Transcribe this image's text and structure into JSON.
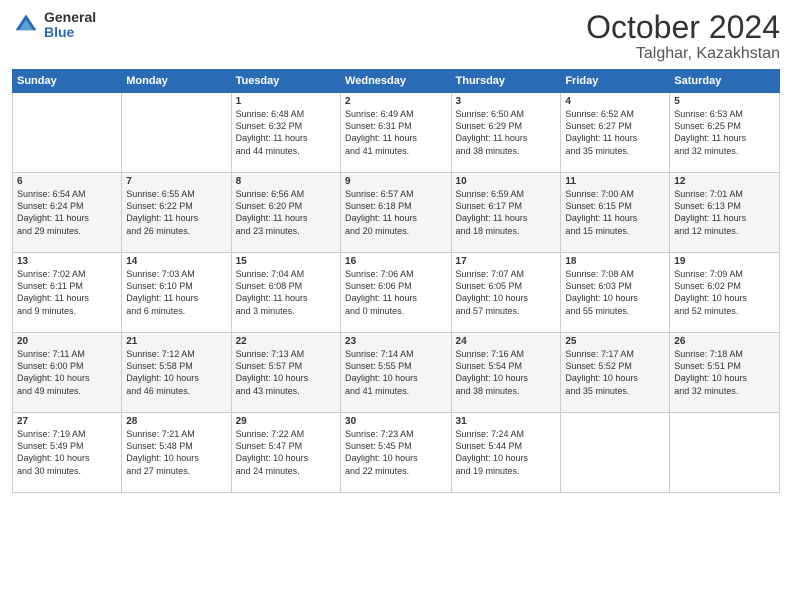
{
  "header": {
    "logo_general": "General",
    "logo_blue": "Blue",
    "month": "October 2024",
    "location": "Talghar, Kazakhstan"
  },
  "days_of_week": [
    "Sunday",
    "Monday",
    "Tuesday",
    "Wednesday",
    "Thursday",
    "Friday",
    "Saturday"
  ],
  "weeks": [
    [
      {
        "num": "",
        "detail": ""
      },
      {
        "num": "",
        "detail": ""
      },
      {
        "num": "1",
        "detail": "Sunrise: 6:48 AM\nSunset: 6:32 PM\nDaylight: 11 hours\nand 44 minutes."
      },
      {
        "num": "2",
        "detail": "Sunrise: 6:49 AM\nSunset: 6:31 PM\nDaylight: 11 hours\nand 41 minutes."
      },
      {
        "num": "3",
        "detail": "Sunrise: 6:50 AM\nSunset: 6:29 PM\nDaylight: 11 hours\nand 38 minutes."
      },
      {
        "num": "4",
        "detail": "Sunrise: 6:52 AM\nSunset: 6:27 PM\nDaylight: 11 hours\nand 35 minutes."
      },
      {
        "num": "5",
        "detail": "Sunrise: 6:53 AM\nSunset: 6:25 PM\nDaylight: 11 hours\nand 32 minutes."
      }
    ],
    [
      {
        "num": "6",
        "detail": "Sunrise: 6:54 AM\nSunset: 6:24 PM\nDaylight: 11 hours\nand 29 minutes."
      },
      {
        "num": "7",
        "detail": "Sunrise: 6:55 AM\nSunset: 6:22 PM\nDaylight: 11 hours\nand 26 minutes."
      },
      {
        "num": "8",
        "detail": "Sunrise: 6:56 AM\nSunset: 6:20 PM\nDaylight: 11 hours\nand 23 minutes."
      },
      {
        "num": "9",
        "detail": "Sunrise: 6:57 AM\nSunset: 6:18 PM\nDaylight: 11 hours\nand 20 minutes."
      },
      {
        "num": "10",
        "detail": "Sunrise: 6:59 AM\nSunset: 6:17 PM\nDaylight: 11 hours\nand 18 minutes."
      },
      {
        "num": "11",
        "detail": "Sunrise: 7:00 AM\nSunset: 6:15 PM\nDaylight: 11 hours\nand 15 minutes."
      },
      {
        "num": "12",
        "detail": "Sunrise: 7:01 AM\nSunset: 6:13 PM\nDaylight: 11 hours\nand 12 minutes."
      }
    ],
    [
      {
        "num": "13",
        "detail": "Sunrise: 7:02 AM\nSunset: 6:11 PM\nDaylight: 11 hours\nand 9 minutes."
      },
      {
        "num": "14",
        "detail": "Sunrise: 7:03 AM\nSunset: 6:10 PM\nDaylight: 11 hours\nand 6 minutes."
      },
      {
        "num": "15",
        "detail": "Sunrise: 7:04 AM\nSunset: 6:08 PM\nDaylight: 11 hours\nand 3 minutes."
      },
      {
        "num": "16",
        "detail": "Sunrise: 7:06 AM\nSunset: 6:06 PM\nDaylight: 11 hours\nand 0 minutes."
      },
      {
        "num": "17",
        "detail": "Sunrise: 7:07 AM\nSunset: 6:05 PM\nDaylight: 10 hours\nand 57 minutes."
      },
      {
        "num": "18",
        "detail": "Sunrise: 7:08 AM\nSunset: 6:03 PM\nDaylight: 10 hours\nand 55 minutes."
      },
      {
        "num": "19",
        "detail": "Sunrise: 7:09 AM\nSunset: 6:02 PM\nDaylight: 10 hours\nand 52 minutes."
      }
    ],
    [
      {
        "num": "20",
        "detail": "Sunrise: 7:11 AM\nSunset: 6:00 PM\nDaylight: 10 hours\nand 49 minutes."
      },
      {
        "num": "21",
        "detail": "Sunrise: 7:12 AM\nSunset: 5:58 PM\nDaylight: 10 hours\nand 46 minutes."
      },
      {
        "num": "22",
        "detail": "Sunrise: 7:13 AM\nSunset: 5:57 PM\nDaylight: 10 hours\nand 43 minutes."
      },
      {
        "num": "23",
        "detail": "Sunrise: 7:14 AM\nSunset: 5:55 PM\nDaylight: 10 hours\nand 41 minutes."
      },
      {
        "num": "24",
        "detail": "Sunrise: 7:16 AM\nSunset: 5:54 PM\nDaylight: 10 hours\nand 38 minutes."
      },
      {
        "num": "25",
        "detail": "Sunrise: 7:17 AM\nSunset: 5:52 PM\nDaylight: 10 hours\nand 35 minutes."
      },
      {
        "num": "26",
        "detail": "Sunrise: 7:18 AM\nSunset: 5:51 PM\nDaylight: 10 hours\nand 32 minutes."
      }
    ],
    [
      {
        "num": "27",
        "detail": "Sunrise: 7:19 AM\nSunset: 5:49 PM\nDaylight: 10 hours\nand 30 minutes."
      },
      {
        "num": "28",
        "detail": "Sunrise: 7:21 AM\nSunset: 5:48 PM\nDaylight: 10 hours\nand 27 minutes."
      },
      {
        "num": "29",
        "detail": "Sunrise: 7:22 AM\nSunset: 5:47 PM\nDaylight: 10 hours\nand 24 minutes."
      },
      {
        "num": "30",
        "detail": "Sunrise: 7:23 AM\nSunset: 5:45 PM\nDaylight: 10 hours\nand 22 minutes."
      },
      {
        "num": "31",
        "detail": "Sunrise: 7:24 AM\nSunset: 5:44 PM\nDaylight: 10 hours\nand 19 minutes."
      },
      {
        "num": "",
        "detail": ""
      },
      {
        "num": "",
        "detail": ""
      }
    ]
  ]
}
